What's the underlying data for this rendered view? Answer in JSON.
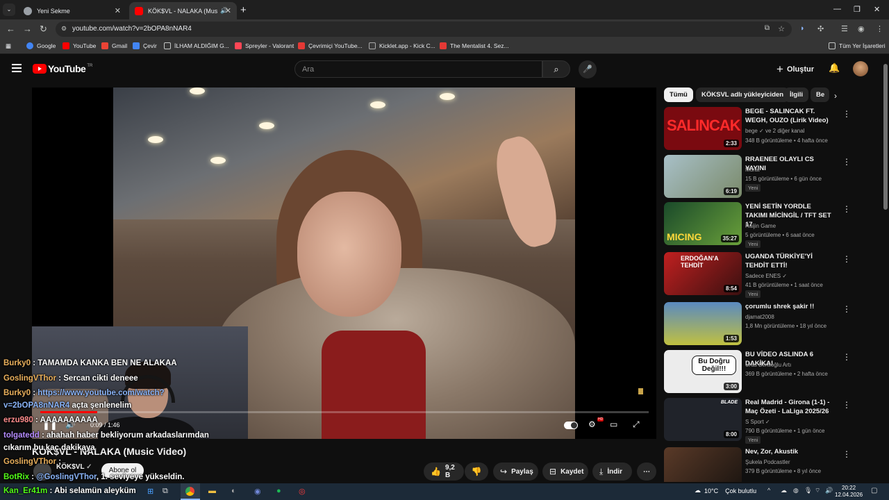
{
  "browser": {
    "tabs": [
      {
        "title": "Yeni Sekme",
        "active": false
      },
      {
        "title": "KÖK$VL - NALAKA (Music V",
        "active": true
      }
    ],
    "new_tab": "+",
    "url": "youtube.com/watch?v=2bOPA8nNAR4",
    "bookmarks": [
      {
        "label": "Google",
        "icon": "google-icon",
        "color": "#4285f4"
      },
      {
        "label": "YouTube",
        "icon": "youtube-icon",
        "color": "#ff0000"
      },
      {
        "label": "Gmail",
        "icon": "gmail-icon",
        "color": "#ea4335"
      },
      {
        "label": "Çevir",
        "icon": "translate-icon",
        "color": "#4285f4"
      },
      {
        "label": "İLHAM ALDIĞIM G...",
        "icon": "folder-icon",
        "color": "#c4c7c5"
      },
      {
        "label": "Spreyler - Valorant",
        "icon": "valorant-icon",
        "color": "#ff4655"
      },
      {
        "label": "Çevrimiçi YouTube...",
        "icon": "converter-icon",
        "color": "#e53935"
      },
      {
        "label": "Kicklet.app - Kick C...",
        "icon": "kicklet-icon",
        "color": "#53fc18"
      },
      {
        "label": "The Mentalist 4. Sez...",
        "icon": "mentalist-icon",
        "color": "#e53935"
      }
    ],
    "all_bookmarks": "Tüm Yer İşaretleri"
  },
  "youtube": {
    "logo": "YouTube",
    "logo_country": "TR",
    "search_placeholder": "Ara",
    "create_label": "Oluştur"
  },
  "player": {
    "progress": 0.094,
    "time": "0:09 / 1:46",
    "hd_badge": "HD"
  },
  "chat": [
    {
      "user": "Burky0",
      "text": " : TAMAMDA KANKA BEN NE ALAKAA"
    },
    {
      "user": "GoslingVThor",
      "text": " : Sercan cikti deneee"
    },
    {
      "user": "Burky0",
      "text": " : ",
      "link": "https://www.youtube.com/watch?"
    },
    {
      "user": "",
      "text": " açta şenlenelim",
      "link": "v=2bOPA8nNAR4"
    },
    {
      "user": "erzu980",
      "text": " : AAAAAAAAAA"
    },
    {
      "user": "tolgatedd",
      "text": " : ahahah haber bekliyorum arkadaslarımdan"
    },
    {
      "user": "",
      "text": "cıkarım bu kaç dakikaya"
    },
    {
      "user": "GoslingVThor",
      "text": " :"
    },
    {
      "user": "BotRix",
      "text": " : ",
      "link": "@GoslingVThor",
      "tail": ", 1. seviyeye yükseldin."
    },
    {
      "user": "Kan_Er41m",
      "text": " : Abi selamün aleyküm"
    }
  ],
  "video": {
    "title": "KÖK$VL - NALAKA (Music Video)",
    "channel": "KÖK$VL",
    "subscribe": "Abone ol",
    "likes": "9,2 B",
    "share": "Paylaş",
    "save": "Kaydet",
    "download": "İndir"
  },
  "chips": [
    "Tümü",
    "KÖKSVL adlı yükleyiciden",
    "İlgili",
    "Be"
  ],
  "recommendations": [
    {
      "title": "BEGE - SALINCAK FT. WEGH, OUZO (Lirik Video)",
      "channel": "bege",
      "channel_extra": "ve 2 diğer kanal",
      "meta": "348 B görüntüleme • 4 hafta önce",
      "duration": "2:33",
      "new": "",
      "thumb": "#7a0a10",
      "thumb_text": "SALINCAK"
    },
    {
      "title": "RRAENEE OLAYLI CS YAYINI",
      "channel": "Murat",
      "channel_extra": "",
      "meta": "15 B görüntüleme • 6 gün önce",
      "duration": "6:19",
      "new": "Yeni",
      "thumb": "#8aa0a8",
      "thumb_text": ""
    },
    {
      "title": "YENİ SETİN YORDLE TAKIMI MİCİNGİL / TFT SET 17",
      "channel": "Raijin Game",
      "channel_extra": "",
      "meta": "5 görüntüleme • 6 saat önce",
      "duration": "35:27",
      "new": "Yeni",
      "thumb": "#2a5a2a",
      "thumb_text": "MICING"
    },
    {
      "title": "UGANDA TÜRKİYE'Yİ TEHDİT ETTİ!",
      "channel": "Sadece ENES",
      "channel_extra": "",
      "meta": "41 B görüntüleme • 1 saat önce",
      "duration": "8:54",
      "new": "Yeni",
      "thumb": "#7a1a1a",
      "thumb_text": "ERDOĞAN'A TEHDİT"
    },
    {
      "title": "çorumlu shrek şakir !!",
      "channel": "djamat2008",
      "channel_extra": "",
      "meta": "1,8 Mn görüntüleme • 18 yıl önce",
      "duration": "1:53",
      "new": "",
      "thumb": "#4a7ab0",
      "thumb_text": ""
    },
    {
      "title": "BU VİDEO ASLINDA 6 DAKİKA!",
      "channel": "Uras Benlioğlu Artı",
      "channel_extra": "",
      "meta": "369 B görüntüleme • 2 hafta önce",
      "duration": "3:00",
      "new": "",
      "thumb": "#e8e8e8",
      "thumb_text": "Bu Doğru Değil!!!"
    },
    {
      "title": "Real Madrid - Girona (1-1) - Maç Özeti - LaLiga 2025/26",
      "channel": "S Sport",
      "channel_extra": "",
      "meta": "790 B görüntüleme • 1 gün önce",
      "duration": "8:00",
      "new": "Yeni",
      "thumb": "#20232a",
      "thumb_text": "BLADE"
    },
    {
      "title": "Nev, Zor, Akustik",
      "channel": "Şukela Podcastler",
      "channel_extra": "",
      "meta": "379 B görüntüleme • 8 yıl önce",
      "duration": "",
      "new": "",
      "thumb": "#3a2a20",
      "thumb_text": ""
    }
  ],
  "taskbar": {
    "weather_temp": "10°C",
    "weather_text": "Çok bulutlu",
    "time": "20:22",
    "date": "12.04.2026"
  }
}
